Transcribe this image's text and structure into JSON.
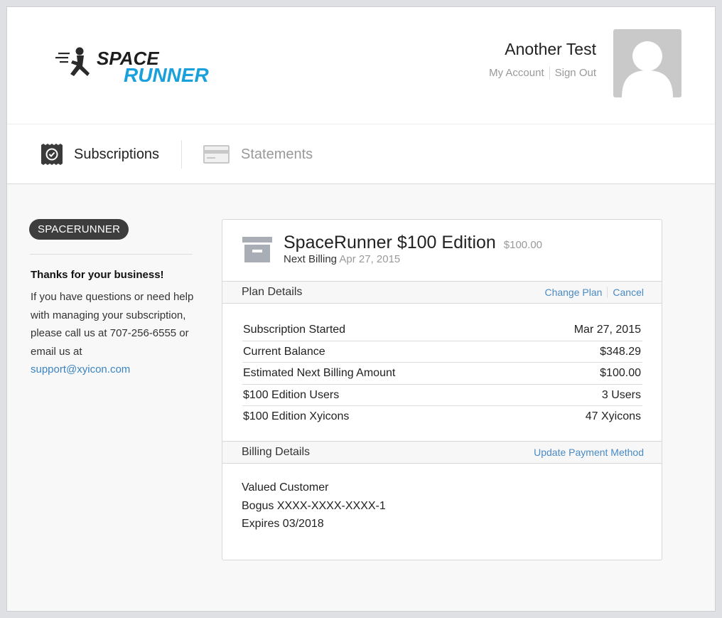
{
  "header": {
    "logo_top": "SPACE",
    "logo_bottom": "RUNNER",
    "user_name": "Another Test",
    "my_account": "My Account",
    "sign_out": "Sign Out"
  },
  "tabs": [
    {
      "label": "Subscriptions",
      "active": true,
      "icon": "check-badge-icon"
    },
    {
      "label": "Statements",
      "active": false,
      "icon": "credit-card-icon"
    }
  ],
  "sidebar": {
    "account_pill": "SPACERUNNER",
    "thanks": "Thanks for your business!",
    "help_text": "If you have questions or need help with managing your subscription, please call us at 707-256-6555 or email us at",
    "email": "support@xyicon.com"
  },
  "plan": {
    "title": "SpaceRunner $100 Edition",
    "price": "$100.00",
    "next_billing_label": "Next Billing",
    "next_billing_date": "Apr 27, 2015"
  },
  "plan_details": {
    "title": "Plan Details",
    "change_plan": "Change Plan",
    "cancel": "Cancel",
    "rows": [
      {
        "label": "Subscription Started",
        "value": "Mar 27, 2015"
      },
      {
        "label": "Current Balance",
        "value": "$348.29"
      },
      {
        "label": "Estimated Next Billing Amount",
        "value": "$100.00"
      },
      {
        "label": "$100 Edition Users",
        "value": "3 Users"
      },
      {
        "label": "$100 Edition Xyicons",
        "value": "47 Xyicons"
      }
    ]
  },
  "billing_details": {
    "title": "Billing Details",
    "update_payment": "Update Payment Method",
    "customer": "Valued Customer",
    "card": "Bogus XXXX-XXXX-XXXX-1",
    "expires": "Expires 03/2018"
  },
  "colors": {
    "accent": "#1aa1dc",
    "link": "#3a84c3",
    "pill_bg": "#3d3d3d"
  }
}
